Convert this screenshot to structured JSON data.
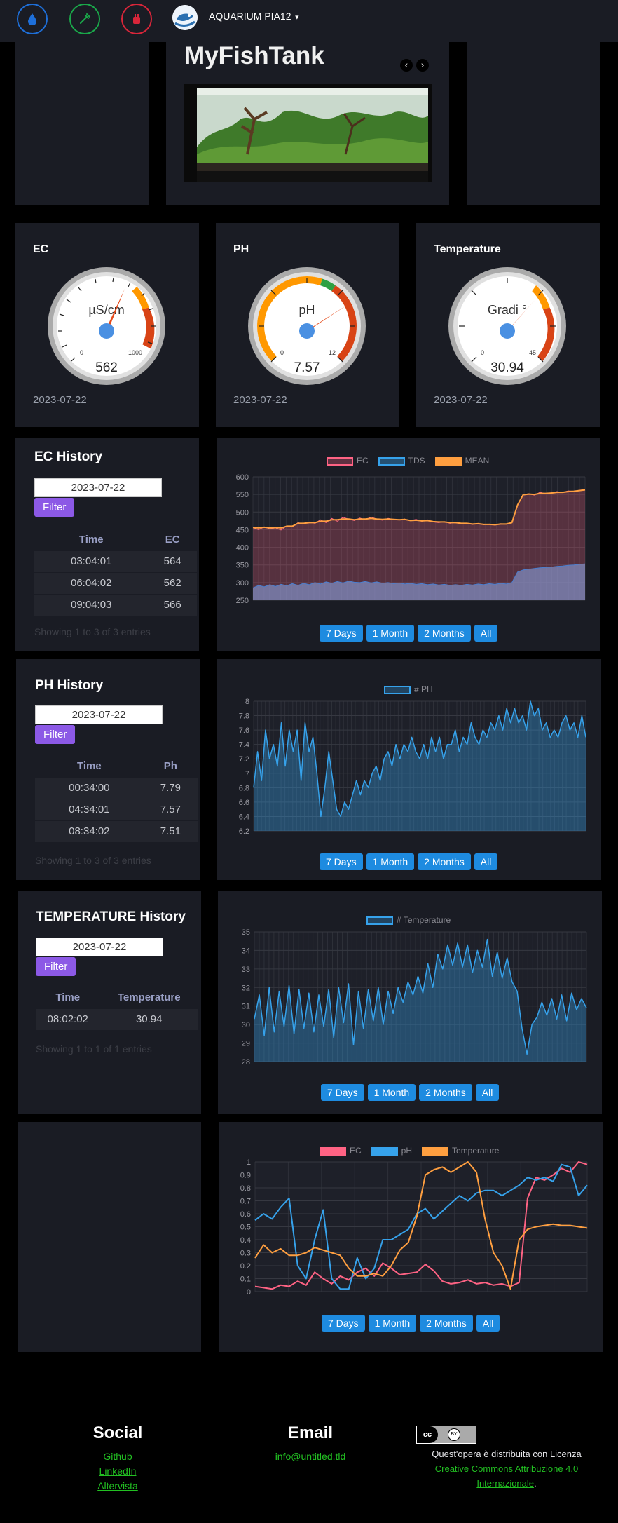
{
  "nav": {
    "brand": "AQUARIUM PIA12",
    "icons": [
      "water-drop-icon",
      "pipette-icon",
      "power-plug-icon"
    ]
  },
  "hero": {
    "title": "MyFishTank",
    "prev": "‹",
    "next": "›"
  },
  "gauges": [
    {
      "title": "EC",
      "unit": "µS/cm",
      "value": "562",
      "min": "0",
      "max": "1000",
      "date": "2023-07-22"
    },
    {
      "title": "PH",
      "unit": "pH",
      "value": "7.57",
      "min": "0",
      "max": "12",
      "date": "2023-07-22"
    },
    {
      "title": "Temperature",
      "unit": "Gradi °",
      "value": "30.94",
      "min": "0",
      "max": "45",
      "date": "2023-07-22"
    }
  ],
  "range_buttons": [
    "7 Days",
    "1 Month",
    "2 Months",
    "All"
  ],
  "filter_label": "Filter",
  "ec_history": {
    "title": "EC History",
    "date": "2023-07-22",
    "headers": [
      "Time",
      "EC"
    ],
    "rows": [
      [
        "03:04:01",
        "564"
      ],
      [
        "06:04:02",
        "562"
      ],
      [
        "09:04:03",
        "566"
      ]
    ],
    "showing": "Showing 1 to 3 of 3 entries"
  },
  "ph_history": {
    "title": "PH History",
    "date": "2023-07-22",
    "headers": [
      "Time",
      "Ph"
    ],
    "rows": [
      [
        "00:34:00",
        "7.79"
      ],
      [
        "04:34:01",
        "7.57"
      ],
      [
        "08:34:02",
        "7.51"
      ]
    ],
    "showing": "Showing 1 to 3 of 3 entries"
  },
  "temp_history": {
    "title": "TEMPERATURE History",
    "date": "2023-07-22",
    "headers": [
      "Time",
      "Temperature"
    ],
    "rows": [
      [
        "08:02:02",
        "30.94"
      ]
    ],
    "showing": "Showing 1 to 1 of 1 entries"
  },
  "footer": {
    "social_title": "Social",
    "social_links": [
      "Github",
      "LinkedIn",
      "Altervista"
    ],
    "email_title": "Email",
    "email": "info@untitled.tld",
    "license_text": "Quest'opera è distribuita con Licenza",
    "license_link": "Creative Commons Attribuzione 4.0 Internazionale",
    "license_end": ".",
    "cc_badge": "BY"
  },
  "colors": {
    "ec": "#ff6384",
    "tds": "#36a2eb",
    "mean": "#ff9f40",
    "ph": "#36a2eb",
    "temp": "#36a2eb",
    "accent": "#8c59e6",
    "button": "#1e8be0"
  },
  "chart_data": [
    {
      "type": "line",
      "id": "ec",
      "legend": [
        "EC",
        "TDS",
        "MEAN"
      ],
      "ylim": [
        250,
        600
      ],
      "yticks": [
        250,
        300,
        350,
        400,
        450,
        500,
        550,
        600
      ],
      "series": [
        {
          "name": "EC",
          "values": [
            456,
            450,
            458,
            452,
            455,
            449,
            461,
            458,
            470,
            466,
            472,
            468,
            478,
            470,
            482,
            474,
            485,
            480,
            476,
            483,
            478,
            486,
            480,
            477,
            482,
            479,
            478,
            480,
            476,
            479,
            474,
            478,
            472,
            470,
            473,
            468,
            471,
            466,
            468,
            465,
            468,
            464,
            466,
            463,
            467,
            466,
            470,
            520,
            550,
            552,
            548,
            556,
            552,
            555,
            558,
            556,
            560,
            559,
            562,
            564
          ]
        },
        {
          "name": "TDS",
          "values": [
            285,
            292,
            288,
            294,
            289,
            295,
            291,
            297,
            292,
            298,
            294,
            300,
            296,
            302,
            298,
            303,
            299,
            304,
            301,
            300,
            303,
            299,
            302,
            298,
            300,
            297,
            299,
            296,
            298,
            295,
            297,
            294,
            296,
            293,
            295,
            292,
            294,
            292,
            295,
            293,
            296,
            294,
            297,
            295,
            298,
            296,
            300,
            330,
            336,
            338,
            340,
            342,
            343,
            344,
            346,
            347,
            349,
            350,
            352,
            353
          ]
        },
        {
          "name": "MEAN",
          "values": [
            456,
            455,
            457,
            455,
            456,
            455,
            460,
            460,
            468,
            468,
            470,
            470,
            474,
            474,
            478,
            478,
            480,
            480,
            478,
            480,
            480,
            482,
            480,
            479,
            480,
            479,
            478,
            479,
            476,
            477,
            475,
            476,
            473,
            472,
            472,
            470,
            470,
            468,
            468,
            466,
            467,
            465,
            465,
            464,
            466,
            466,
            470,
            520,
            549,
            551,
            550,
            553,
            553,
            554,
            556,
            556,
            558,
            559,
            561,
            563
          ]
        }
      ]
    },
    {
      "type": "area",
      "id": "ph",
      "legend": [
        "# PH"
      ],
      "ylim": [
        6.2,
        8.0
      ],
      "yticks": [
        6.2,
        6.4,
        6.6,
        6.8,
        7.0,
        7.2,
        7.4,
        7.6,
        7.8,
        8.0
      ],
      "series": [
        {
          "name": "# PH",
          "values": [
            6.8,
            7.3,
            6.9,
            7.6,
            7.2,
            7.4,
            7.1,
            7.7,
            7.1,
            7.6,
            7.3,
            7.6,
            6.9,
            7.7,
            7.3,
            7.5,
            7.0,
            6.4,
            6.8,
            7.3,
            6.9,
            6.5,
            6.4,
            6.6,
            6.5,
            6.7,
            6.9,
            6.7,
            6.9,
            6.8,
            7.0,
            7.1,
            6.9,
            7.2,
            7.3,
            7.1,
            7.4,
            7.2,
            7.4,
            7.3,
            7.5,
            7.3,
            7.2,
            7.4,
            7.2,
            7.5,
            7.3,
            7.5,
            7.2,
            7.4,
            7.4,
            7.6,
            7.3,
            7.5,
            7.4,
            7.7,
            7.5,
            7.4,
            7.6,
            7.5,
            7.7,
            7.6,
            7.8,
            7.6,
            7.9,
            7.7,
            7.9,
            7.7,
            7.8,
            7.6,
            8.0,
            7.8,
            7.9,
            7.6,
            7.7,
            7.5,
            7.6,
            7.5,
            7.7,
            7.8,
            7.6,
            7.7,
            7.5,
            7.8,
            7.5
          ]
        }
      ]
    },
    {
      "type": "area",
      "id": "temp",
      "legend": [
        "# Temperature"
      ],
      "ylim": [
        28,
        35
      ],
      "yticks": [
        28,
        29,
        30,
        31,
        32,
        33,
        34,
        35
      ],
      "series": [
        {
          "name": "# Temperature",
          "values": [
            30.3,
            31.6,
            29.4,
            32.0,
            29.6,
            31.8,
            29.9,
            32.1,
            29.5,
            31.9,
            29.8,
            31.7,
            29.6,
            31.6,
            29.9,
            31.9,
            29.3,
            32.0,
            30.1,
            32.2,
            28.9,
            31.8,
            29.8,
            31.9,
            30.2,
            32.0,
            30.0,
            31.8,
            30.6,
            32.0,
            31.2,
            32.3,
            31.6,
            32.6,
            31.7,
            33.3,
            32.0,
            33.8,
            33.0,
            34.3,
            33.2,
            34.4,
            33.1,
            34.3,
            32.8,
            34.0,
            33.1,
            34.6,
            32.6,
            33.9,
            32.5,
            33.6,
            32.3,
            31.8,
            29.8,
            28.4,
            30.0,
            30.4,
            31.2,
            30.5,
            31.4,
            30.3,
            31.6,
            30.2,
            31.7,
            30.8,
            31.4,
            30.9
          ]
        }
      ]
    },
    {
      "type": "line",
      "id": "norm",
      "legend": [
        "EC",
        "pH",
        "Temperature"
      ],
      "ylim": [
        0,
        1
      ],
      "yticks": [
        0,
        0.1,
        0.2,
        0.3,
        0.4,
        0.5,
        0.6,
        0.7,
        0.8,
        0.9,
        1.0
      ],
      "series": [
        {
          "name": "EC",
          "values": [
            0.04,
            0.03,
            0.02,
            0.05,
            0.04,
            0.08,
            0.05,
            0.15,
            0.1,
            0.06,
            0.12,
            0.09,
            0.15,
            0.18,
            0.12,
            0.22,
            0.18,
            0.13,
            0.14,
            0.15,
            0.21,
            0.16,
            0.08,
            0.06,
            0.07,
            0.09,
            0.06,
            0.07,
            0.05,
            0.06,
            0.04,
            0.07,
            0.72,
            0.88,
            0.86,
            0.9,
            0.95,
            0.92,
            1.0,
            0.98
          ]
        },
        {
          "name": "pH",
          "values": [
            0.55,
            0.6,
            0.56,
            0.65,
            0.72,
            0.2,
            0.1,
            0.4,
            0.63,
            0.1,
            0.02,
            0.02,
            0.26,
            0.1,
            0.18,
            0.4,
            0.4,
            0.44,
            0.48,
            0.6,
            0.64,
            0.56,
            0.62,
            0.68,
            0.74,
            0.7,
            0.76,
            0.78,
            0.78,
            0.74,
            0.78,
            0.82,
            0.88,
            0.86,
            0.88,
            0.85,
            0.98,
            0.96,
            0.74,
            0.82
          ]
        },
        {
          "name": "Temperature",
          "values": [
            0.26,
            0.36,
            0.3,
            0.33,
            0.28,
            0.28,
            0.3,
            0.34,
            0.32,
            0.3,
            0.28,
            0.18,
            0.12,
            0.12,
            0.14,
            0.12,
            0.2,
            0.32,
            0.38,
            0.58,
            0.9,
            0.94,
            0.96,
            0.92,
            0.96,
            1.0,
            0.92,
            0.56,
            0.3,
            0.2,
            0.02,
            0.4,
            0.48,
            0.5,
            0.51,
            0.52,
            0.51,
            0.51,
            0.5,
            0.49
          ]
        }
      ]
    }
  ]
}
